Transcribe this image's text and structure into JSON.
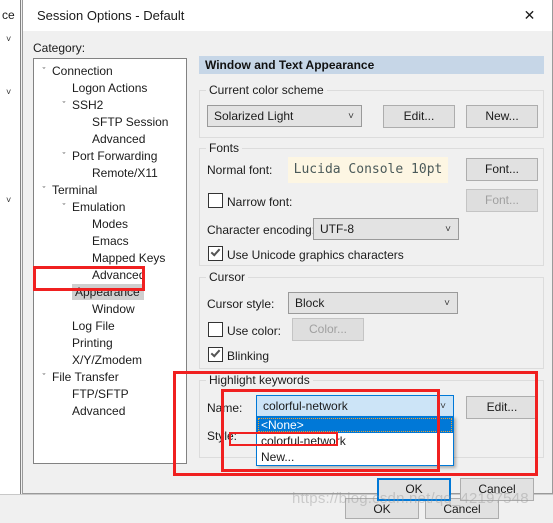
{
  "background_window": {
    "partial_label": "ce",
    "ok_label": "OK",
    "cancel_label": "Cancel"
  },
  "dialog": {
    "title": "Session Options - Default",
    "close_icon": "close-icon",
    "category_label": "Category:",
    "panel_header": "Window and Text Appearance"
  },
  "tree": {
    "items": [
      {
        "label": "Connection",
        "indent": 0,
        "chevron": "ˇ",
        "selected": false
      },
      {
        "label": "Logon Actions",
        "indent": 1,
        "chevron": "",
        "selected": false
      },
      {
        "label": "SSH2",
        "indent": 1,
        "chevron": "ˇ",
        "selected": false
      },
      {
        "label": "SFTP Session",
        "indent": 2,
        "chevron": "",
        "selected": false
      },
      {
        "label": "Advanced",
        "indent": 2,
        "chevron": "",
        "selected": false
      },
      {
        "label": "Port Forwarding",
        "indent": 1,
        "chevron": "ˇ",
        "selected": false
      },
      {
        "label": "Remote/X11",
        "indent": 2,
        "chevron": "",
        "selected": false
      },
      {
        "label": "Terminal",
        "indent": 0,
        "chevron": "ˇ",
        "selected": false
      },
      {
        "label": "Emulation",
        "indent": 1,
        "chevron": "ˇ",
        "selected": false
      },
      {
        "label": "Modes",
        "indent": 2,
        "chevron": "",
        "selected": false
      },
      {
        "label": "Emacs",
        "indent": 2,
        "chevron": "",
        "selected": false
      },
      {
        "label": "Mapped Keys",
        "indent": 2,
        "chevron": "",
        "selected": false
      },
      {
        "label": "Advanced",
        "indent": 2,
        "chevron": "",
        "selected": false
      },
      {
        "label": "Appearance",
        "indent": 1,
        "chevron": "ˇ",
        "selected": true
      },
      {
        "label": "Window",
        "indent": 2,
        "chevron": "",
        "selected": false
      },
      {
        "label": "Log File",
        "indent": 1,
        "chevron": "",
        "selected": false
      },
      {
        "label": "Printing",
        "indent": 1,
        "chevron": "",
        "selected": false
      },
      {
        "label": "X/Y/Zmodem",
        "indent": 1,
        "chevron": "",
        "selected": false
      },
      {
        "label": "File Transfer",
        "indent": 0,
        "chevron": "ˇ",
        "selected": false
      },
      {
        "label": "FTP/SFTP",
        "indent": 1,
        "chevron": "",
        "selected": false
      },
      {
        "label": "Advanced",
        "indent": 1,
        "chevron": "",
        "selected": false
      }
    ]
  },
  "color_scheme": {
    "group_title": "Current color scheme",
    "value": "Solarized Light",
    "edit_label": "Edit...",
    "new_label": "New..."
  },
  "fonts": {
    "group_title": "Fonts",
    "normal_font_label": "Normal font:",
    "normal_font_value": "Lucida Console 10pt",
    "normal_font_button": "Font...",
    "narrow_font_label": "Narrow font:",
    "narrow_font_checked": false,
    "narrow_font_button": "Font...",
    "encoding_label": "Character encoding:",
    "encoding_value": "UTF-8",
    "unicode_graphics_label": "Use Unicode graphics characters",
    "unicode_graphics_checked": true
  },
  "cursor": {
    "group_title": "Cursor",
    "style_label": "Cursor style:",
    "style_value": "Block",
    "use_color_label": "Use color:",
    "use_color_checked": false,
    "color_button": "Color...",
    "blinking_label": "Blinking",
    "blinking_checked": true
  },
  "highlight_keywords": {
    "group_title": "Highlight keywords",
    "name_label": "Name:",
    "name_value": "colorful-network",
    "style_label": "Style:",
    "edit_label": "Edit...",
    "options": [
      {
        "label": "<None>",
        "selected": true
      },
      {
        "label": "colorful-network",
        "selected": false
      },
      {
        "label": "New...",
        "selected": false
      }
    ]
  },
  "footer": {
    "ok_label": "OK",
    "cancel_label": "Cancel"
  },
  "watermark": "https://blog.csdn.net/qq_42197548",
  "colors": {
    "accent": "#0078d7",
    "annotation": "#f02020",
    "panel_header_bg": "#c6d6e7",
    "font_preview_bg": "#fdf6e3",
    "combo_highlight_bg": "#cce4f7"
  }
}
